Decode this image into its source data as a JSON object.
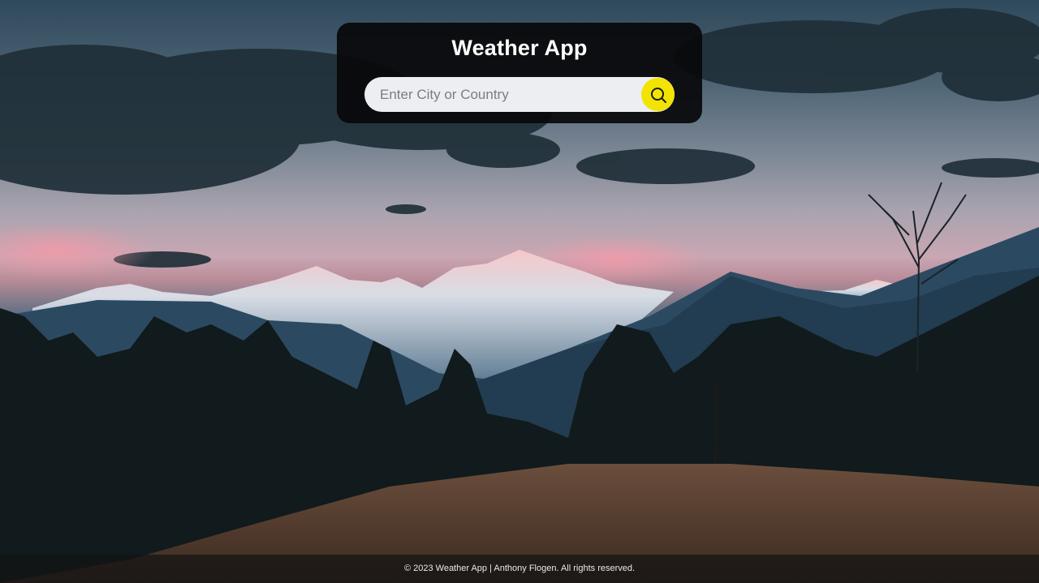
{
  "app": {
    "title": "Weather App"
  },
  "search": {
    "placeholder": "Enter City or Country",
    "value": "",
    "button_icon": "search-icon"
  },
  "footer": {
    "text": "© 2023 Weather App | Anthony Flogen. All rights reserved."
  },
  "colors": {
    "accent": "#f2e400",
    "card_bg": "#08080a",
    "input_bg": "#eceef1"
  }
}
